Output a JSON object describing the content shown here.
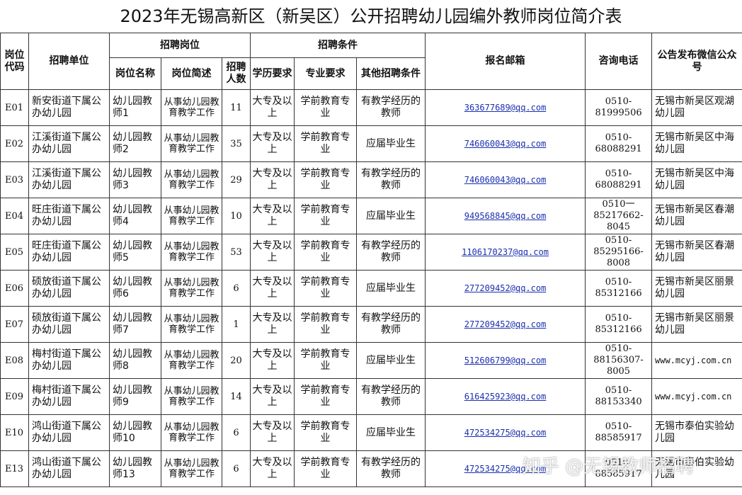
{
  "title": "2023年无锡高新区（新吴区）公开招聘幼儿园编外教师岗位简介表",
  "headers": {
    "code": "岗位代码",
    "unit": "招聘单位",
    "position_group": "招聘岗位",
    "position_name": "岗位名称",
    "position_desc": "岗位简述",
    "count": "招聘人数",
    "cond_group": "招聘条件",
    "education": "学历要求",
    "major": "专业要求",
    "other": "其他招聘条件",
    "email": "报名邮箱",
    "phone": "咨询电话",
    "wechat": "公告发布微信公众号"
  },
  "rows": [
    {
      "code": "E01",
      "unit": "新安街道下属公办幼儿园",
      "name": "幼儿园教师1",
      "desc": "从事幼儿园教育教学工作",
      "count": "11",
      "edu": "大专及以上",
      "major": "学前教育专业",
      "other": "有教学经历的教师",
      "email": "363677689@qq.com",
      "phone": "0510-81999506",
      "wechat": "无锡市新吴区观湖幼儿园"
    },
    {
      "code": "E02",
      "unit": "江溪街道下属公办幼儿园",
      "name": "幼儿园教师2",
      "desc": "从事幼儿园教育教学工作",
      "count": "35",
      "edu": "大专及以上",
      "major": "学前教育专业",
      "other": "应届毕业生",
      "email": "746060043@qq.com",
      "phone": "0510-68088291",
      "wechat": "无锡市新吴区中海幼儿园"
    },
    {
      "code": "E03",
      "unit": "江溪街道下属公办幼儿园",
      "name": "幼儿园教师3",
      "desc": "从事幼儿园教育教学工作",
      "count": "29",
      "edu": "大专及以上",
      "major": "学前教育专业",
      "other": "有教学经历的教师",
      "email": "746060043@qq.com",
      "phone": "0510-68088291",
      "wechat": "无锡市新吴区中海幼儿园"
    },
    {
      "code": "E04",
      "unit": "旺庄街道下属公办幼儿园",
      "name": "幼儿园教师4",
      "desc": "从事幼儿园教育教学工作",
      "count": "10",
      "edu": "大专及以上",
      "major": "学前教育专业",
      "other": "应届毕业生",
      "email": "949568845@qq.com",
      "phone": "0510一85217662-8045",
      "wechat": "无锡市新吴区春潮幼儿园"
    },
    {
      "code": "E05",
      "unit": "旺庄街道下属公办幼儿园",
      "name": "幼儿园教师5",
      "desc": "从事幼儿园教育教学工作",
      "count": "53",
      "edu": "大专及以上",
      "major": "学前教育专业",
      "other": "有教学经历的教师",
      "email": "1106170237@qq.com",
      "phone": "0510-85295166-8008",
      "wechat": "无锡市新吴区春潮幼儿园"
    },
    {
      "code": "E06",
      "unit": "硕放街道下属公办幼儿园",
      "name": "幼儿园教师6",
      "desc": "从事幼儿园教育教学工作",
      "count": "6",
      "edu": "大专及以上",
      "major": "学前教育专业",
      "other": "应届毕业生",
      "email": "277209452@qq.com",
      "phone": "0510-85312166",
      "wechat": "无锡市新吴区丽景幼儿园"
    },
    {
      "code": "E07",
      "unit": "硕放街道下属公办幼儿园",
      "name": "幼儿园教师7",
      "desc": "从事幼儿园教育教学工作",
      "count": "1",
      "edu": "大专及以上",
      "major": "学前教育专业",
      "other": "有教学经历的教师",
      "email": "277209452@qq.com",
      "phone": "0510-85312166",
      "wechat": "无锡市新吴区丽景幼儿园"
    },
    {
      "code": "E08",
      "unit": "梅村街道下属公办幼儿园",
      "name": "幼儿园教师8",
      "desc": "从事幼儿园教育教学工作",
      "count": "20",
      "edu": "大专及以上",
      "major": "学前教育专业",
      "other": "应届毕业生",
      "email": "512606799@qq.com",
      "phone": "0510-88156307-8005",
      "wechat": "www.mcyj.com.cn"
    },
    {
      "code": "E09",
      "unit": "梅村街道下属公办幼儿园",
      "name": "幼儿园教师9",
      "desc": "从事幼儿园教育教学工作",
      "count": "14",
      "edu": "大专及以上",
      "major": "学前教育专业",
      "other": "有教学经历的教师",
      "email": "616425923@qq.com",
      "phone": "0510-88153340",
      "wechat": "www.mcyj.com.cn"
    },
    {
      "code": "E10",
      "unit": "鸿山街道下属公办幼儿园",
      "name": "幼儿园教师10",
      "desc": "从事幼儿园教育教学工作",
      "count": "6",
      "edu": "大专及以上",
      "major": "学前教育专业",
      "other": "应届毕业生",
      "email": "472534275@qq.com",
      "phone": "0510-88585917",
      "wechat": "无锡市泰伯实验幼儿园"
    },
    {
      "code": "E13",
      "unit": "鸿山街道下属公办幼儿园",
      "name": "幼儿园教师13",
      "desc": "从事幼儿园教育教学工作",
      "count": "6",
      "edu": "大专及以上",
      "major": "学前教育专业",
      "other": "有教学经历的教师",
      "email": "472534275@qq.com",
      "phone": "0510-88585917",
      "wechat": "无锡市泰伯实验幼儿园"
    }
  ],
  "watermark": "知乎 @无锡教师招聘",
  "colors": {
    "link": "#1a2fb0",
    "border": "#333333"
  }
}
